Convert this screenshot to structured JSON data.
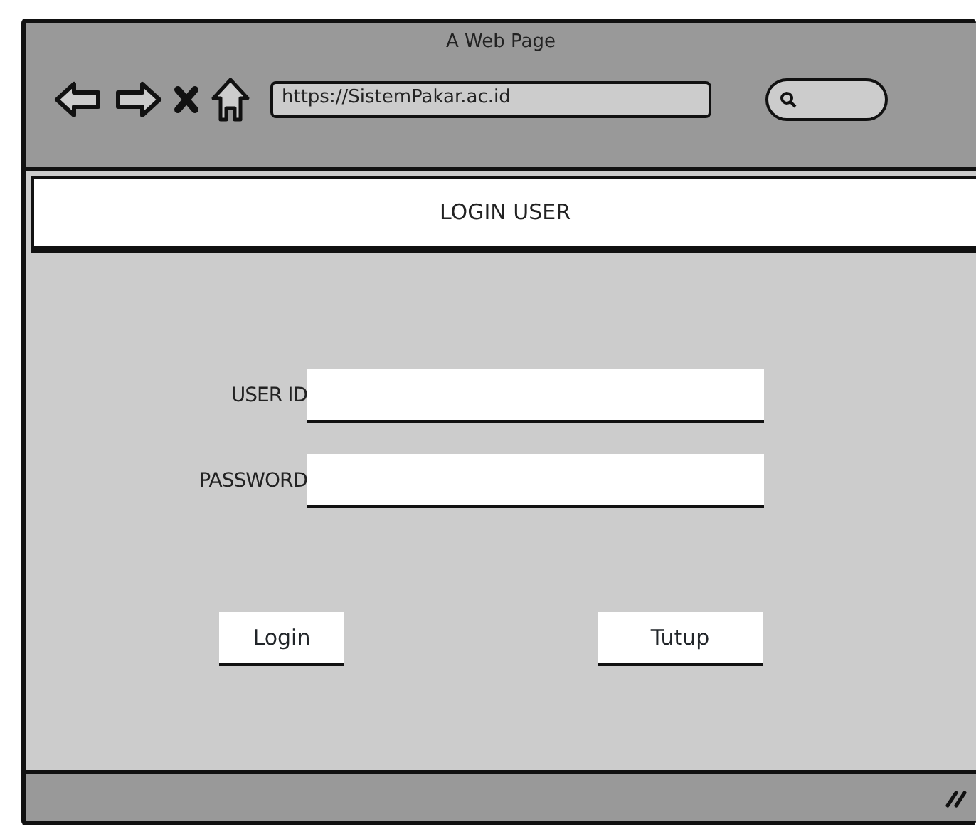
{
  "window": {
    "title": "A Web Page"
  },
  "address_bar": {
    "url": "https://SistemPakar.ac.id"
  },
  "header": {
    "title": "LOGIN USER"
  },
  "form": {
    "fields": [
      {
        "label": "USER ID"
      },
      {
        "label": "PASSWORD"
      }
    ]
  },
  "buttons": [
    {
      "label": "Login"
    },
    {
      "label": "Tutup"
    }
  ]
}
